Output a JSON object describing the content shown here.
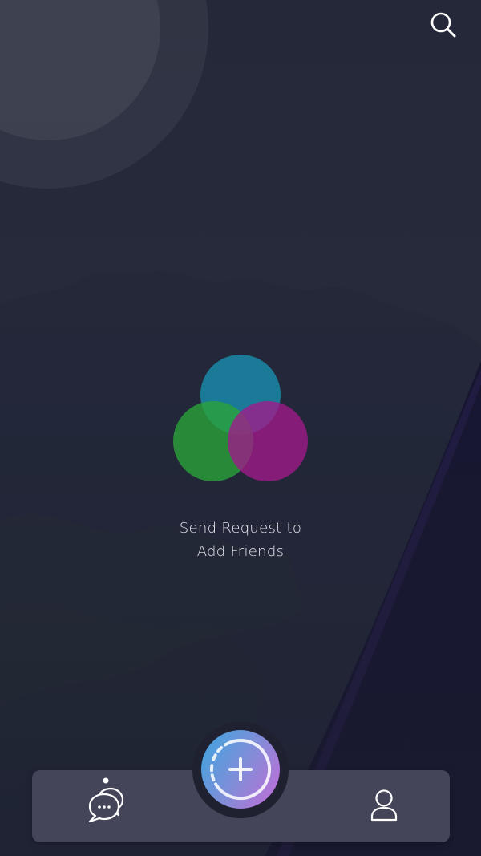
{
  "header": {
    "search_icon": "search-icon"
  },
  "empty_state": {
    "icon": "overlapping-circles-icon",
    "message_line1": "Send Request to",
    "message_line2": "Add Friends",
    "circle_colors": [
      "#1a8aa8",
      "#2aa33a",
      "#a21a8a"
    ]
  },
  "bottom_nav": {
    "chats_icon": "chat-bubbles-icon",
    "chats_active": true,
    "add_button_icon": "plus-icon",
    "profile_icon": "user-icon"
  },
  "colors": {
    "background": "#252838",
    "nav_bar": "#444558",
    "fab_gradient_start": "#3aa6e0",
    "fab_gradient_end": "#c66ad9"
  }
}
